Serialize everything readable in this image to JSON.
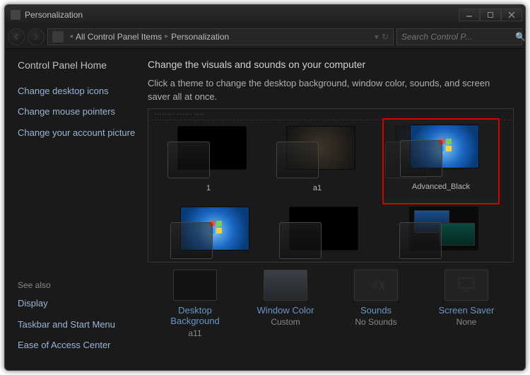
{
  "window": {
    "title": "Personalization"
  },
  "breadcrumb": {
    "item1": "All Control Panel Items",
    "item2": "Personalization"
  },
  "search": {
    "placeholder": "Search Control P..."
  },
  "sidebar": {
    "home": "Control Panel Home",
    "links": [
      "Change desktop icons",
      "Change mouse pointers",
      "Change your account picture"
    ],
    "see_also_label": "See also",
    "see_also": [
      "Display",
      "Taskbar and Start Menu",
      "Ease of Access Center"
    ]
  },
  "main": {
    "heading": "Change the visuals and sounds on your computer",
    "subtext": "Click a theme to change the desktop background, window color, sounds, and screen saver all at once.",
    "section_label": "········ ······ ····"
  },
  "themes": [
    {
      "label": "1"
    },
    {
      "label": "a1"
    },
    {
      "label": "Advanced_Black",
      "selected": true
    },
    {
      "label": ""
    },
    {
      "label": ""
    },
    {
      "label": ""
    }
  ],
  "bottom": {
    "desktop_bg": {
      "label": "Desktop Background",
      "sub": "a11"
    },
    "window_color": {
      "label": "Window Color",
      "sub": "Custom"
    },
    "sounds": {
      "label": "Sounds",
      "sub": "No Sounds"
    },
    "screen_saver": {
      "label": "Screen Saver",
      "sub": "None"
    }
  }
}
